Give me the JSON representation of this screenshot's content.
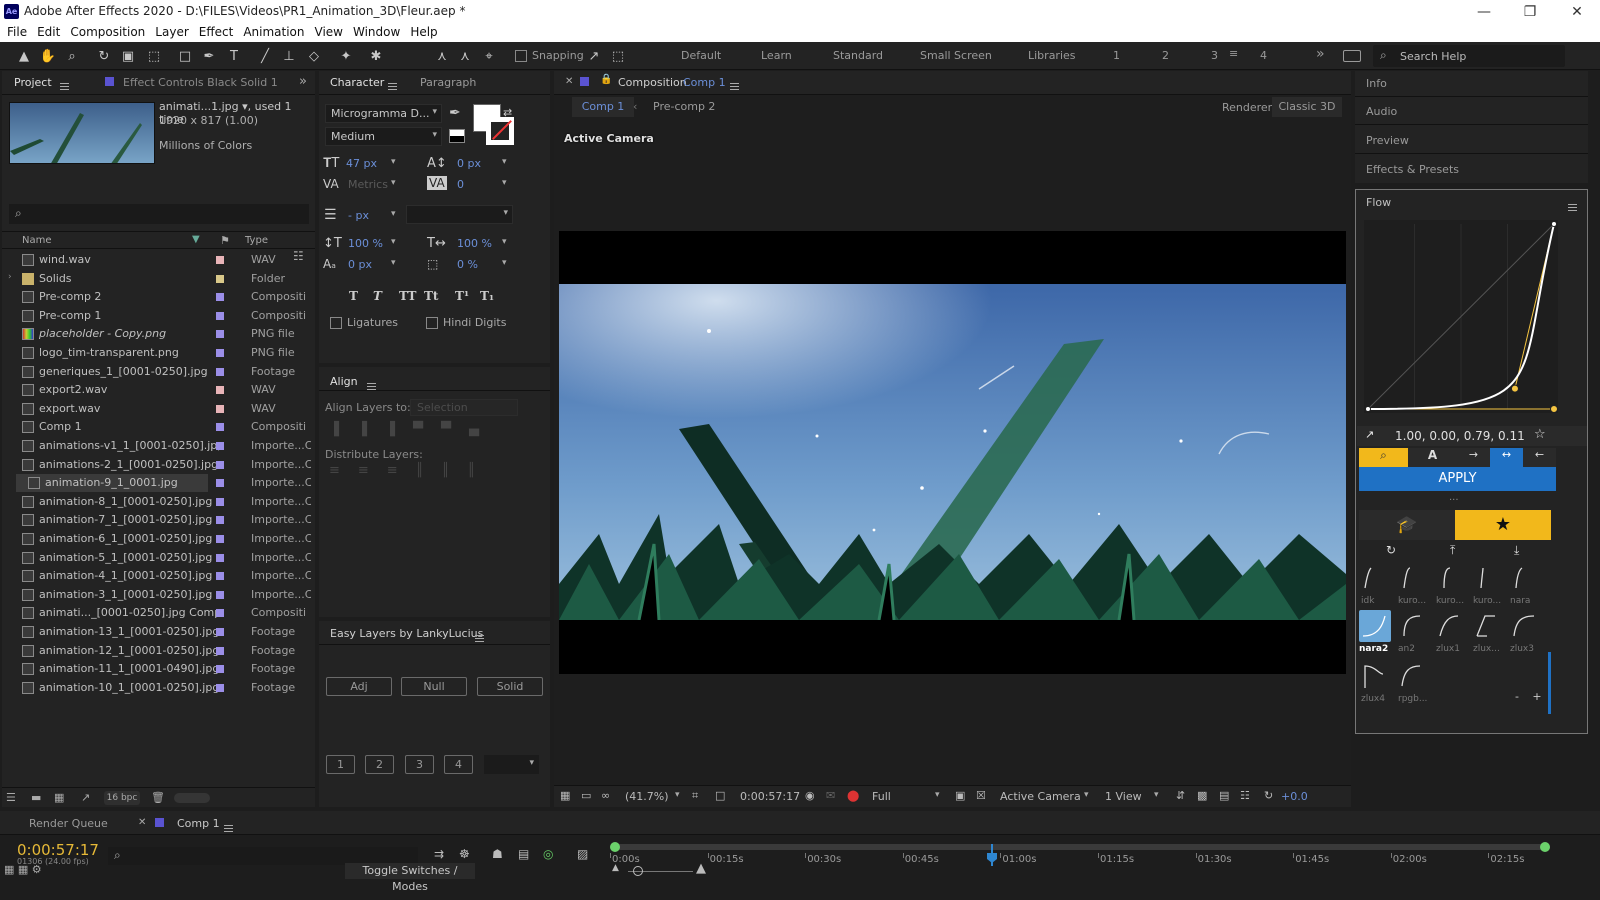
{
  "window": {
    "title": "Adobe After Effects 2020 - D:\\FILES\\Videos\\PR1_Animation_3D\\Fleur.aep *",
    "app_badge": "Ae",
    "min": "—",
    "max": "❐",
    "close": "✕"
  },
  "menu": [
    "File",
    "Edit",
    "Composition",
    "Layer",
    "Effect",
    "Animation",
    "View",
    "Window",
    "Help"
  ],
  "toolbar": {
    "snapping": "Snapping",
    "workspaces": [
      "Default",
      "Learn",
      "Standard",
      "Small Screen",
      "Libraries",
      "1",
      "2",
      "3",
      "4"
    ],
    "search_placeholder": "Search Help"
  },
  "project": {
    "tab": "Project",
    "effect_tab": "Effect Controls Black Solid 1",
    "preview_name": "animati...1.jpg ▾, used 1 time",
    "preview_dims": "1920 x 817 (1.00)",
    "preview_colors": "Millions of Colors",
    "col_name": "Name",
    "col_type": "Type",
    "items": [
      {
        "name": "wind.wav",
        "type": "WAV",
        "color": "#e8b4b8"
      },
      {
        "name": "Solids",
        "type": "Folder",
        "color": "#d9c88a"
      },
      {
        "name": "Pre-comp 2",
        "type": "Compositi",
        "color": "#9b8ee8"
      },
      {
        "name": "Pre-comp 1",
        "type": "Compositi",
        "color": "#9b8ee8"
      },
      {
        "name": "placeholder - Copy.png",
        "type": "PNG file",
        "color": "#9b8ee8"
      },
      {
        "name": "logo_tim-transparent.png",
        "type": "PNG file",
        "color": "#9b8ee8"
      },
      {
        "name": "generiques_1_[0001-0250].jpg",
        "type": "Footage",
        "color": "#9b8ee8"
      },
      {
        "name": "export2.wav",
        "type": "WAV",
        "color": "#e8b4b8"
      },
      {
        "name": "export.wav",
        "type": "WAV",
        "color": "#e8b4b8"
      },
      {
        "name": "Comp 1",
        "type": "Compositi",
        "color": "#9b8ee8"
      },
      {
        "name": "animations-v1_1_[0001-0250].jpg",
        "type": "Importe...C",
        "color": "#9b8ee8"
      },
      {
        "name": "animations-2_1_[0001-0250].jpg",
        "type": "Importe...C",
        "color": "#9b8ee8"
      },
      {
        "name": "animation-9_1_0001.jpg",
        "type": "Importe...C",
        "color": "#9b8ee8"
      },
      {
        "name": "animation-8_1_[0001-0250].jpg",
        "type": "Importe...C",
        "color": "#9b8ee8"
      },
      {
        "name": "animation-7_1_[0001-0250].jpg",
        "type": "Importe...C",
        "color": "#9b8ee8"
      },
      {
        "name": "animation-6_1_[0001-0250].jpg",
        "type": "Importe...C",
        "color": "#9b8ee8"
      },
      {
        "name": "animation-5_1_[0001-0250].jpg",
        "type": "Importe...C",
        "color": "#9b8ee8"
      },
      {
        "name": "animation-4_1_[0001-0250].jpg",
        "type": "Importe...C",
        "color": "#9b8ee8"
      },
      {
        "name": "animation-3_1_[0001-0250].jpg",
        "type": "Importe...C",
        "color": "#9b8ee8"
      },
      {
        "name": "animati..._[0001-0250].jpg Comp 1",
        "type": "Compositi",
        "color": "#9b8ee8"
      },
      {
        "name": "animation-13_1_[0001-0250].jpg",
        "type": "Footage",
        "color": "#9b8ee8"
      },
      {
        "name": "animation-12_1_[0001-0250].jpg",
        "type": "Footage",
        "color": "#9b8ee8"
      },
      {
        "name": "animation-11_1_[0001-0490].jpg",
        "type": "Footage",
        "color": "#9b8ee8"
      },
      {
        "name": "animation-10_1_[0001-0250].jpg",
        "type": "Footage",
        "color": "#9b8ee8"
      }
    ],
    "bpc": "16 bpc"
  },
  "character": {
    "tab": "Character",
    "tab2": "Paragraph",
    "font": "Microgramma D...",
    "style": "Medium",
    "size": "47 px",
    "leading": "0 px",
    "kerning": "Metrics",
    "tracking": "0",
    "stroke": "- px",
    "vscale": "100 %",
    "hscale": "100 %",
    "baseline": "0 px",
    "tsume": "0 %",
    "styles": [
      "T",
      "T",
      "TT",
      "Tt",
      "T¹",
      "T₁"
    ],
    "ligatures": "Ligatures",
    "hindi": "Hindi Digits"
  },
  "align": {
    "tab": "Align",
    "align_to_label": "Align Layers to:",
    "align_to_value": "Selection",
    "distribute": "Distribute Layers:"
  },
  "easy": {
    "tab": "Easy Layers by LankyLucius",
    "buttons": [
      "Adj",
      "Null",
      "Solid"
    ],
    "nums": [
      "1",
      "2",
      "3",
      "4"
    ]
  },
  "comp": {
    "tab_prefix": "Composition",
    "tab_name": "Comp 1",
    "crumbs": [
      "Comp 1",
      "Pre-comp 2"
    ],
    "renderer_label": "Renderer:",
    "renderer": "Classic 3D",
    "camera_label": "Active Camera",
    "footer": {
      "zoom": "(41.7%)",
      "time": "0:00:57:17",
      "res": "Full",
      "camera": "Active Camera",
      "views": "1 View",
      "exposure": "+0.0"
    }
  },
  "right": {
    "tabs": [
      "Info",
      "Audio",
      "Preview",
      "Effects & Presets"
    ],
    "flow": {
      "title": "Flow",
      "values": "1.00, 0.00, 0.79, 0.11",
      "apply": "APPLY",
      "dots": "...",
      "preset_labels": [
        "idk",
        "kuro...",
        "kuro...",
        "kuro...",
        "nara",
        "nara2",
        "an2",
        "zlux1",
        "zlux...",
        "zlux3",
        "zlux4",
        "rpgb..."
      ],
      "minus": "-",
      "plus": "+"
    }
  },
  "timeline": {
    "render_queue": "Render Queue",
    "comp_tab": "Comp 1",
    "timecode": "0:00:57:17",
    "frames": "01306 (24.00 fps)",
    "toggle": "Toggle Switches / Modes",
    "ticks": [
      "0:00s",
      "00:15s",
      "00:30s",
      "00:45s",
      "01:00s",
      "01:15s",
      "01:30s",
      "01:45s",
      "02:00s",
      "02:15s"
    ]
  },
  "chart_data": {
    "type": "line",
    "values": [
      1.0,
      0.0,
      0.79,
      0.11
    ]
  }
}
